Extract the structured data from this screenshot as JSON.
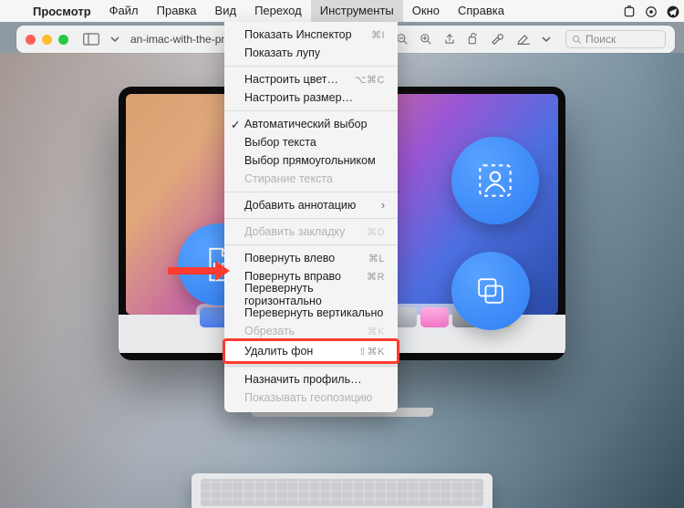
{
  "menubar": {
    "app_name": "Просмотр",
    "items": [
      "Файл",
      "Правка",
      "Вид",
      "Переход",
      "Инструменты",
      "Окно",
      "Справка"
    ],
    "open_index": 4
  },
  "window": {
    "title": "an-imac-with-the-preview-a…",
    "search_placeholder": "Поиск"
  },
  "tools_menu": {
    "groups": [
      [
        {
          "label": "Показать Инспектор",
          "shortcut": "⌘I",
          "enabled": true
        },
        {
          "label": "Показать лупу",
          "shortcut": "",
          "enabled": true
        }
      ],
      [
        {
          "label": "Настроить цвет…",
          "shortcut": "⌥⌘C",
          "enabled": true
        },
        {
          "label": "Настроить размер…",
          "shortcut": "",
          "enabled": true
        }
      ],
      [
        {
          "label": "Автоматический выбор",
          "shortcut": "",
          "enabled": true,
          "checked": true
        },
        {
          "label": "Выбор текста",
          "shortcut": "",
          "enabled": true
        },
        {
          "label": "Выбор прямоугольником",
          "shortcut": "",
          "enabled": true
        },
        {
          "label": "Стирание текста",
          "shortcut": "",
          "enabled": false
        }
      ],
      [
        {
          "label": "Добавить аннотацию",
          "shortcut": "",
          "enabled": true,
          "submenu": true
        }
      ],
      [
        {
          "label": "Добавить закладку",
          "shortcut": "⌘D",
          "enabled": false
        }
      ],
      [
        {
          "label": "Повернуть влево",
          "shortcut": "⌘L",
          "enabled": true
        },
        {
          "label": "Повернуть вправо",
          "shortcut": "⌘R",
          "enabled": true
        },
        {
          "label": "Перевернуть горизонтально",
          "shortcut": "",
          "enabled": true
        },
        {
          "label": "Перевернуть вертикально",
          "shortcut": "",
          "enabled": true
        },
        {
          "label": "Обрезать",
          "shortcut": "⌘K",
          "enabled": false
        },
        {
          "label": "Удалить фон",
          "shortcut": "⇧⌘K",
          "enabled": true,
          "highlight": true
        }
      ],
      [
        {
          "label": "Назначить профиль…",
          "shortcut": "",
          "enabled": true
        },
        {
          "label": "Показывать геопозицию",
          "shortcut": "",
          "enabled": false
        }
      ]
    ]
  }
}
